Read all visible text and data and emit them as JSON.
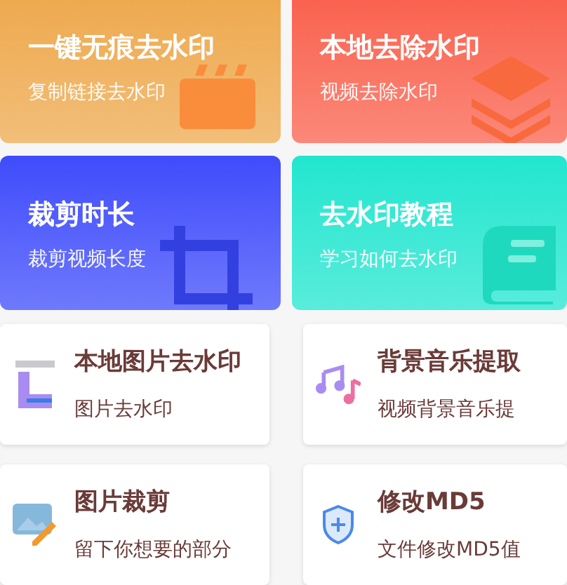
{
  "feature_cards": [
    {
      "title": "一键无痕去水印",
      "subtitle": "复制链接去水印",
      "color": "#eea84c"
    },
    {
      "title": "本地去除水印",
      "subtitle": "视频去除水印",
      "color": "#f9604c"
    },
    {
      "title": "裁剪时长",
      "subtitle": "裁剪视频长度",
      "color": "#3f4cfb"
    },
    {
      "title": "去水印教程",
      "subtitle": "学习如何去水印",
      "color": "#22e6cf"
    }
  ],
  "tool_cards": [
    {
      "title": "本地图片去水印",
      "subtitle": "图片去水印"
    },
    {
      "title": "背景音乐提取",
      "subtitle": "视频背景音乐提"
    },
    {
      "title": "图片裁剪",
      "subtitle": "留下你想要的部分"
    },
    {
      "title": "修改MD5",
      "subtitle": "文件修改MD5值"
    }
  ]
}
